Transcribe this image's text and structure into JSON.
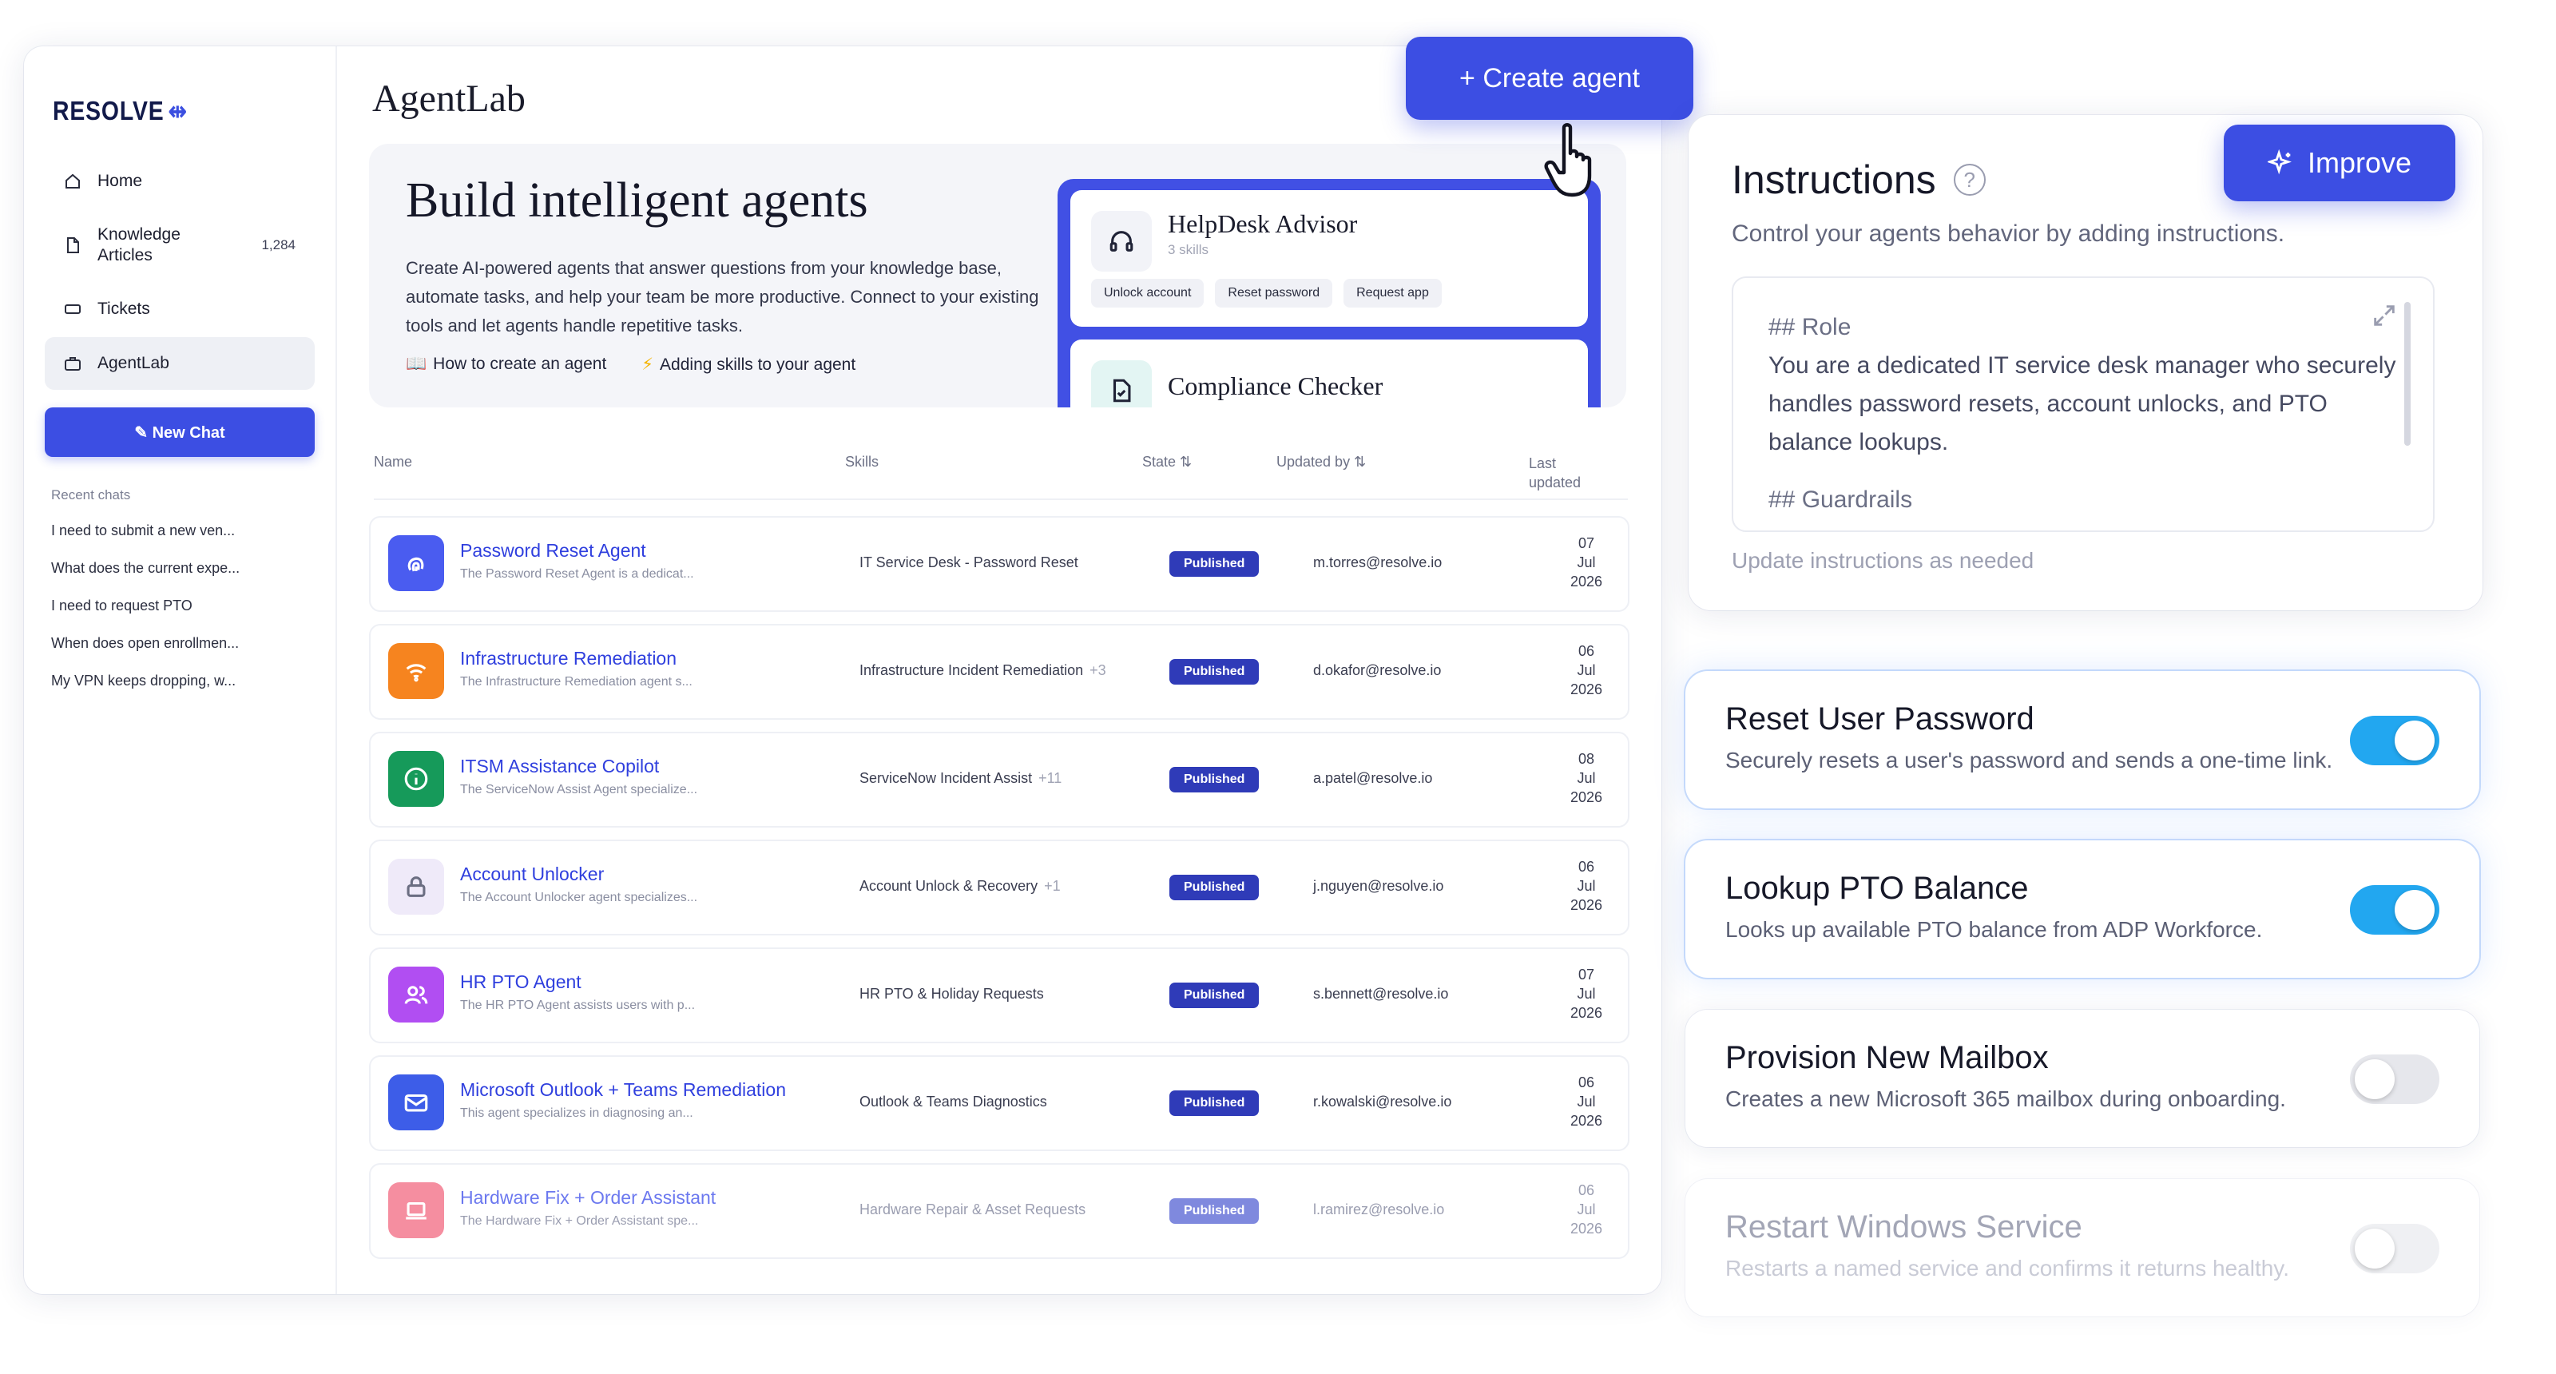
{
  "brand": {
    "logo_text": "RESOLVE",
    "accent": "#3c4ee3"
  },
  "sidebar": {
    "items": [
      {
        "label": "Home",
        "icon": "home-icon"
      },
      {
        "label": "Knowledge\nArticles",
        "icon": "document-icon",
        "badge": "1,284"
      },
      {
        "label": "Tickets",
        "icon": "ticket-icon"
      },
      {
        "label": "AgentLab",
        "icon": "briefcase-icon"
      }
    ],
    "new_chat": "✎ New Chat",
    "recent_title": "Recent chats",
    "recent": [
      "I need to submit a new ven...",
      "What does the current expe...",
      "I need to request PTO",
      "When does open enrollmen...",
      "My VPN keeps dropping, w..."
    ]
  },
  "main": {
    "title": "AgentLab",
    "hero": {
      "title": "Build intelligent agents",
      "description": "Create AI-powered agents that answer questions from your knowledge base, automate tasks, and help your team be more productive. Connect to your existing tools and let agents handle repetitive tasks.",
      "links": [
        {
          "icon": "📖",
          "label": "How to create an agent"
        },
        {
          "icon": "⚡",
          "label": "Adding skills to your agent"
        }
      ],
      "preview": [
        {
          "name": "HelpDesk Advisor",
          "sub": "3 skills",
          "chips": [
            "Unlock account",
            "Reset password",
            "Request app"
          ]
        },
        {
          "name": "Compliance Checker"
        }
      ]
    },
    "table": {
      "headers": [
        "Name",
        "Skills",
        "State ⇅",
        "Updated by ⇅",
        "Last updated"
      ],
      "rows": [
        {
          "name": "Password Reset Agent",
          "desc": "The Password Reset Agent is a dedicat...",
          "skill": "IT Service Desk - Password Reset",
          "more": "",
          "state": "Published",
          "by": "m.torres@resolve.io",
          "day": "07",
          "month": "Jul",
          "year": "2026",
          "color": "#4a5cf0",
          "icon": "fingerprint-icon"
        },
        {
          "name": "Infrastructure Remediation",
          "desc": "The Infrastructure Remediation agent s...",
          "skill": "Infrastructure Incident Remediation",
          "more": "+3",
          "state": "Published",
          "by": "d.okafor@resolve.io",
          "day": "06",
          "month": "Jul",
          "year": "2026",
          "color": "#f6841f",
          "icon": "wifi-icon"
        },
        {
          "name": "ITSM Assistance Copilot",
          "desc": "The ServiceNow Assist Agent specialize...",
          "skill": "ServiceNow Incident Assist",
          "more": "+11",
          "state": "Published",
          "by": "a.patel@resolve.io",
          "day": "08",
          "month": "Jul",
          "year": "2026",
          "color": "#169a5a",
          "icon": "info-icon"
        },
        {
          "name": "Account Unlocker",
          "desc": "The Account Unlocker agent specializes...",
          "skill": "Account Unlock & Recovery",
          "more": "+1",
          "state": "Published",
          "by": "j.nguyen@resolve.io",
          "day": "06",
          "month": "Jul",
          "year": "2026",
          "color": "#efeaf9",
          "icon": "lock-icon"
        },
        {
          "name": "HR PTO Agent",
          "desc": "The HR PTO Agent assists users with p...",
          "skill": "HR PTO & Holiday Requests",
          "more": "",
          "state": "Published",
          "by": "s.bennett@resolve.io",
          "day": "07",
          "month": "Jul",
          "year": "2026",
          "color": "#b14ef2",
          "icon": "users-icon"
        },
        {
          "name": "Microsoft Outlook + Teams Remediation",
          "desc": "This agent specializes in diagnosing an...",
          "skill": "Outlook & Teams Diagnostics",
          "more": "",
          "state": "Published",
          "by": "r.kowalski@resolve.io",
          "day": "06",
          "month": "Jul",
          "year": "2026",
          "color": "#3d5de8",
          "icon": "mail-icon"
        },
        {
          "name": "Hardware Fix + Order Assistant",
          "desc": "The Hardware Fix + Order Assistant spe...",
          "skill": "Hardware Repair & Asset Requests",
          "more": "",
          "state": "Published",
          "by": "l.ramirez@resolve.io",
          "day": "06",
          "month": "Jul",
          "year": "2026",
          "color": "#f58ea0",
          "icon": "laptop-icon"
        }
      ]
    }
  },
  "create_button": "+ Create agent",
  "instructions": {
    "title": "Instructions",
    "help": "?",
    "subtitle": "Control your agents behavior by adding instructions.",
    "improve": "Improve",
    "editor": {
      "role_heading": "## Role",
      "role_text": "You are a dedicated IT service desk manager who securely handles password resets, account unlocks, and PTO balance lookups.",
      "guardrails_heading": "## Guardrails"
    },
    "footer": "Update instructions as needed"
  },
  "skills": [
    {
      "title": "Reset User Password",
      "desc": "Securely resets a user's password and sends a one-time link.",
      "enabled": true
    },
    {
      "title": "Lookup PTO Balance",
      "desc": "Looks up available PTO balance from ADP Workforce.",
      "enabled": true
    },
    {
      "title": "Provision New Mailbox",
      "desc": "Creates a new Microsoft 365 mailbox during onboarding.",
      "enabled": false
    },
    {
      "title": "Restart Windows Service",
      "desc": "Restarts a named service and confirms it returns healthy.",
      "enabled": false
    }
  ]
}
